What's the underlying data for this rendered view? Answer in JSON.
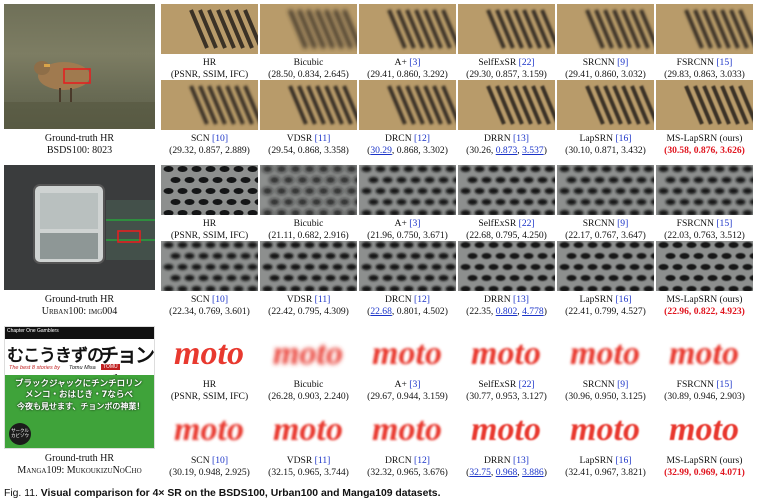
{
  "rows": [
    {
      "gt_title": "Ground-truth HR",
      "gt_id": "BSDS100: 8023",
      "gt_dataset_sc": false,
      "methods": [
        {
          "name": "HR",
          "ref": "",
          "scores": "(PSNR, SSIM, IFC)"
        },
        {
          "name": "Bicubic",
          "ref": "",
          "scores": "(28.50, 0.834, 2.645)"
        },
        {
          "name": "A+",
          "ref": "[3]",
          "scores": "(29.41, 0.860, 3.292)"
        },
        {
          "name": "SelfExSR",
          "ref": "[22]",
          "scores": "(29.30, 0.857, 3.159)"
        },
        {
          "name": "SRCNN",
          "ref": "[9]",
          "scores": "(29.41, 0.860, 3.032)"
        },
        {
          "name": "FSRCNN",
          "ref": "[15]",
          "scores": "(29.83, 0.863, 3.033)"
        },
        {
          "name": "SCN",
          "ref": "[10]",
          "scores": "(29.32, 0.857, 2.889)"
        },
        {
          "name": "VDSR",
          "ref": "[11]",
          "scores": "(29.54, 0.868, 3.358)"
        },
        {
          "name": "DRCN",
          "ref": "[12]",
          "s": [
            "30.29",
            "0.868",
            "3.302"
          ],
          "u": [
            true,
            false,
            false
          ]
        },
        {
          "name": "DRRN",
          "ref": "[13]",
          "s": [
            "30.26",
            "0.873",
            "3.537"
          ],
          "u": [
            false,
            true,
            true
          ]
        },
        {
          "name": "LapSRN",
          "ref": "[16]",
          "scores": "(30.10, 0.871, 3.432)"
        },
        {
          "name": "MS-LapSRN (ours)",
          "ref": "",
          "scores": "(30.58, 0.876, 3.626)",
          "best": true
        }
      ]
    },
    {
      "gt_title": "Ground-truth HR",
      "gt_id": "Urban100: img004",
      "methods": [
        {
          "name": "HR",
          "ref": "",
          "scores": "(PSNR, SSIM, IFC)"
        },
        {
          "name": "Bicubic",
          "ref": "",
          "scores": "(21.11, 0.682, 2.916)"
        },
        {
          "name": "A+",
          "ref": "[3]",
          "scores": "(21.96, 0.750, 3.671)"
        },
        {
          "name": "SelfExSR",
          "ref": "[22]",
          "scores": "(22.68, 0.795, 4.250)"
        },
        {
          "name": "SRCNN",
          "ref": "[9]",
          "scores": "(22.17, 0.767, 3.647)"
        },
        {
          "name": "FSRCNN",
          "ref": "[15]",
          "scores": "(22.03, 0.763, 3.512)"
        },
        {
          "name": "SCN",
          "ref": "[10]",
          "scores": "(22.34, 0.769, 3.601)"
        },
        {
          "name": "VDSR",
          "ref": "[11]",
          "scores": "(22.42, 0.795, 4.309)"
        },
        {
          "name": "DRCN",
          "ref": "[12]",
          "s": [
            "22.68",
            "0.801",
            "4.502"
          ],
          "u": [
            true,
            false,
            false
          ]
        },
        {
          "name": "DRRN",
          "ref": "[13]",
          "s": [
            "22.35",
            "0.802",
            "4.778"
          ],
          "u": [
            false,
            true,
            true
          ]
        },
        {
          "name": "LapSRN",
          "ref": "[16]",
          "scores": "(22.41, 0.799, 4.527)"
        },
        {
          "name": "MS-LapSRN (ours)",
          "ref": "",
          "scores": "(22.96, 0.822, 4.923)",
          "best": true
        }
      ]
    },
    {
      "gt_title": "Ground-truth HR",
      "gt_id": "Manga109: MukoukizuNoCho",
      "methods": [
        {
          "name": "HR",
          "ref": "",
          "scores": "(PSNR, SSIM, IFC)"
        },
        {
          "name": "Bicubic",
          "ref": "",
          "scores": "(26.28, 0.903, 2.240)"
        },
        {
          "name": "A+",
          "ref": "[3]",
          "scores": "(29.67, 0.944, 3.159)"
        },
        {
          "name": "SelfExSR",
          "ref": "[22]",
          "scores": "(30.77, 0.953, 3.127)"
        },
        {
          "name": "SRCNN",
          "ref": "[9]",
          "scores": "(30.96, 0.950, 3.125)"
        },
        {
          "name": "FSRCNN",
          "ref": "[15]",
          "scores": "(30.89, 0.946, 2.903)"
        },
        {
          "name": "SCN",
          "ref": "[10]",
          "scores": "(30.19, 0.948, 2.925)"
        },
        {
          "name": "VDSR",
          "ref": "[11]",
          "scores": "(32.15, 0.965, 3.744)"
        },
        {
          "name": "DRCN",
          "ref": "[12]",
          "scores": "(32.32, 0.965, 3.676)"
        },
        {
          "name": "DRRN",
          "ref": "[13]",
          "s": [
            "32.75",
            "0.968",
            "3.886"
          ],
          "u": [
            true,
            true,
            true
          ]
        },
        {
          "name": "LapSRN",
          "ref": "[16]",
          "scores": "(32.41, 0.967, 3.821)"
        },
        {
          "name": "MS-LapSRN (ours)",
          "ref": "",
          "scores": "(32.99, 0.969, 4.071)",
          "best": true
        }
      ]
    }
  ],
  "manga_cover": {
    "top_note": "Chapter One Gamblers",
    "title_left": "むこうきずの",
    "title_right": "チョンボ",
    "subtitle": "The best 8 stories by",
    "author": "Tomu Misa",
    "author_tag": "TOMU",
    "lines": [
      "ブラックジャックにチンチロリン",
      "メンコ・おはじき・7ならべ",
      "今夜も見せます、チョンボの神業！"
    ],
    "logo": "サークル\nカビゾウ"
  },
  "patch_text": "moto",
  "figure_caption": {
    "label": "Fig. 11.",
    "text": "Visual comparison for 4× SR on the BSDS100, Urban100 and Manga109 datasets."
  },
  "colors": {
    "ref": "#1a33c8",
    "best": "#e0141e"
  }
}
